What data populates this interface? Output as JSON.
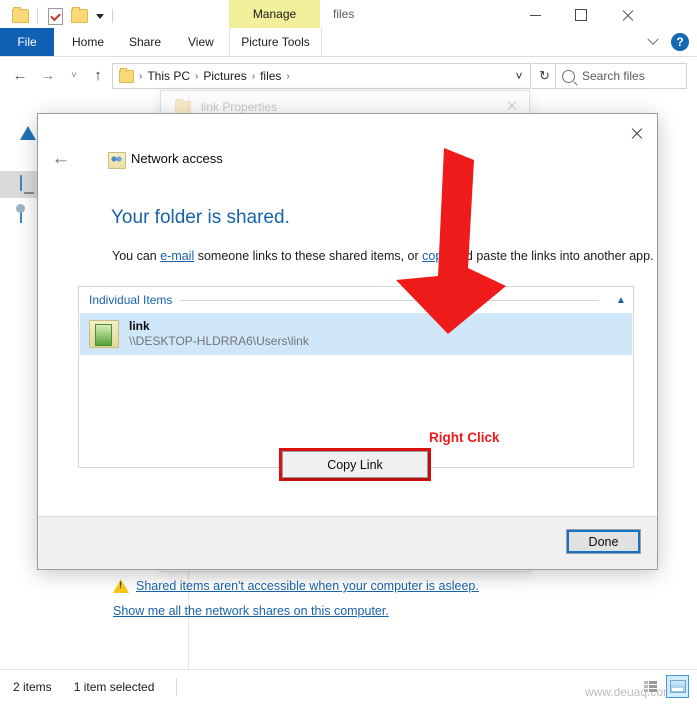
{
  "explorer": {
    "title": "files",
    "quick_access": {
      "folder_icon": "folder-icon",
      "properties_icon": "properties-icon",
      "new_folder_icon": "new-folder-icon",
      "customize_icon": "chevron-down-icon"
    },
    "contextual_tab": "Manage",
    "tabs": [
      {
        "label": "File"
      },
      {
        "label": "Home"
      },
      {
        "label": "Share"
      },
      {
        "label": "View"
      },
      {
        "label": "Picture Tools"
      }
    ],
    "window_controls": {
      "minimize": "minimize-icon",
      "maximize": "maximize-icon",
      "close": "close-icon",
      "collapse_ribbon": "chevron-down-icon",
      "help": "?"
    },
    "address": {
      "back": "←",
      "forward": "→",
      "history": "˅",
      "up": "↑",
      "breadcrumbs": [
        "This PC",
        "Pictures",
        "files"
      ],
      "separator": "›",
      "dropdown": "˅",
      "refresh": "↻"
    },
    "search": {
      "placeholder": "Search files",
      "icon": "search-icon"
    },
    "sidebar": [
      {
        "label": "",
        "icon": "quick-access-pin-icon"
      },
      {
        "label": "",
        "icon": "onedrive-cloud-icon"
      },
      {
        "label": "",
        "icon": "this-pc-icon"
      },
      {
        "label": "",
        "icon": "network-icon"
      }
    ],
    "status": {
      "item_count": "2 items",
      "selection": "1 item selected",
      "watermark": "www.deuaq.com",
      "view_list_icon": "list-view-icon",
      "view_details_icon": "details-view-icon"
    }
  },
  "properties_dialog": {
    "title": "link Properties",
    "folder_icon": "folder-icon",
    "close_icon": "close-icon"
  },
  "network_dialog": {
    "close_icon": "close-icon",
    "back_icon": "back-arrow-icon",
    "header_icon": "network-access-icon",
    "header_title": "Network access",
    "heading": "Your folder is shared.",
    "body_prefix": "You can ",
    "link_email": "e-mail",
    "body_middle": " someone links to these shared items, or ",
    "link_copy": "copy",
    "body_suffix": " and paste the links into another app.",
    "group": {
      "title": "Individual Items",
      "collapse_icon": "chevron-up-icon",
      "item": {
        "icon": "shared-folder-icon",
        "name": "link",
        "path": "\\\\DESKTOP-HLDRRA6\\Users\\link"
      }
    },
    "context_menu": {
      "items": [
        "Copy Link"
      ]
    },
    "annotation": {
      "label": "Right Click",
      "color": "#ed1c1c",
      "arrow": "red-down-arrow"
    },
    "warning": {
      "icon": "warning-icon",
      "link": "Shared items aren't accessible when your computer is asleep."
    },
    "network_shares_link": "Show me all the network shares on this computer.",
    "done_button": "Done"
  },
  "colors": {
    "accent_blue": "#1862ab",
    "file_tab": "#0f5fb5",
    "manage_tab": "#f2f09a",
    "annotation_red": "#ed1c1c",
    "selection_blue": "#cfe7f9"
  }
}
